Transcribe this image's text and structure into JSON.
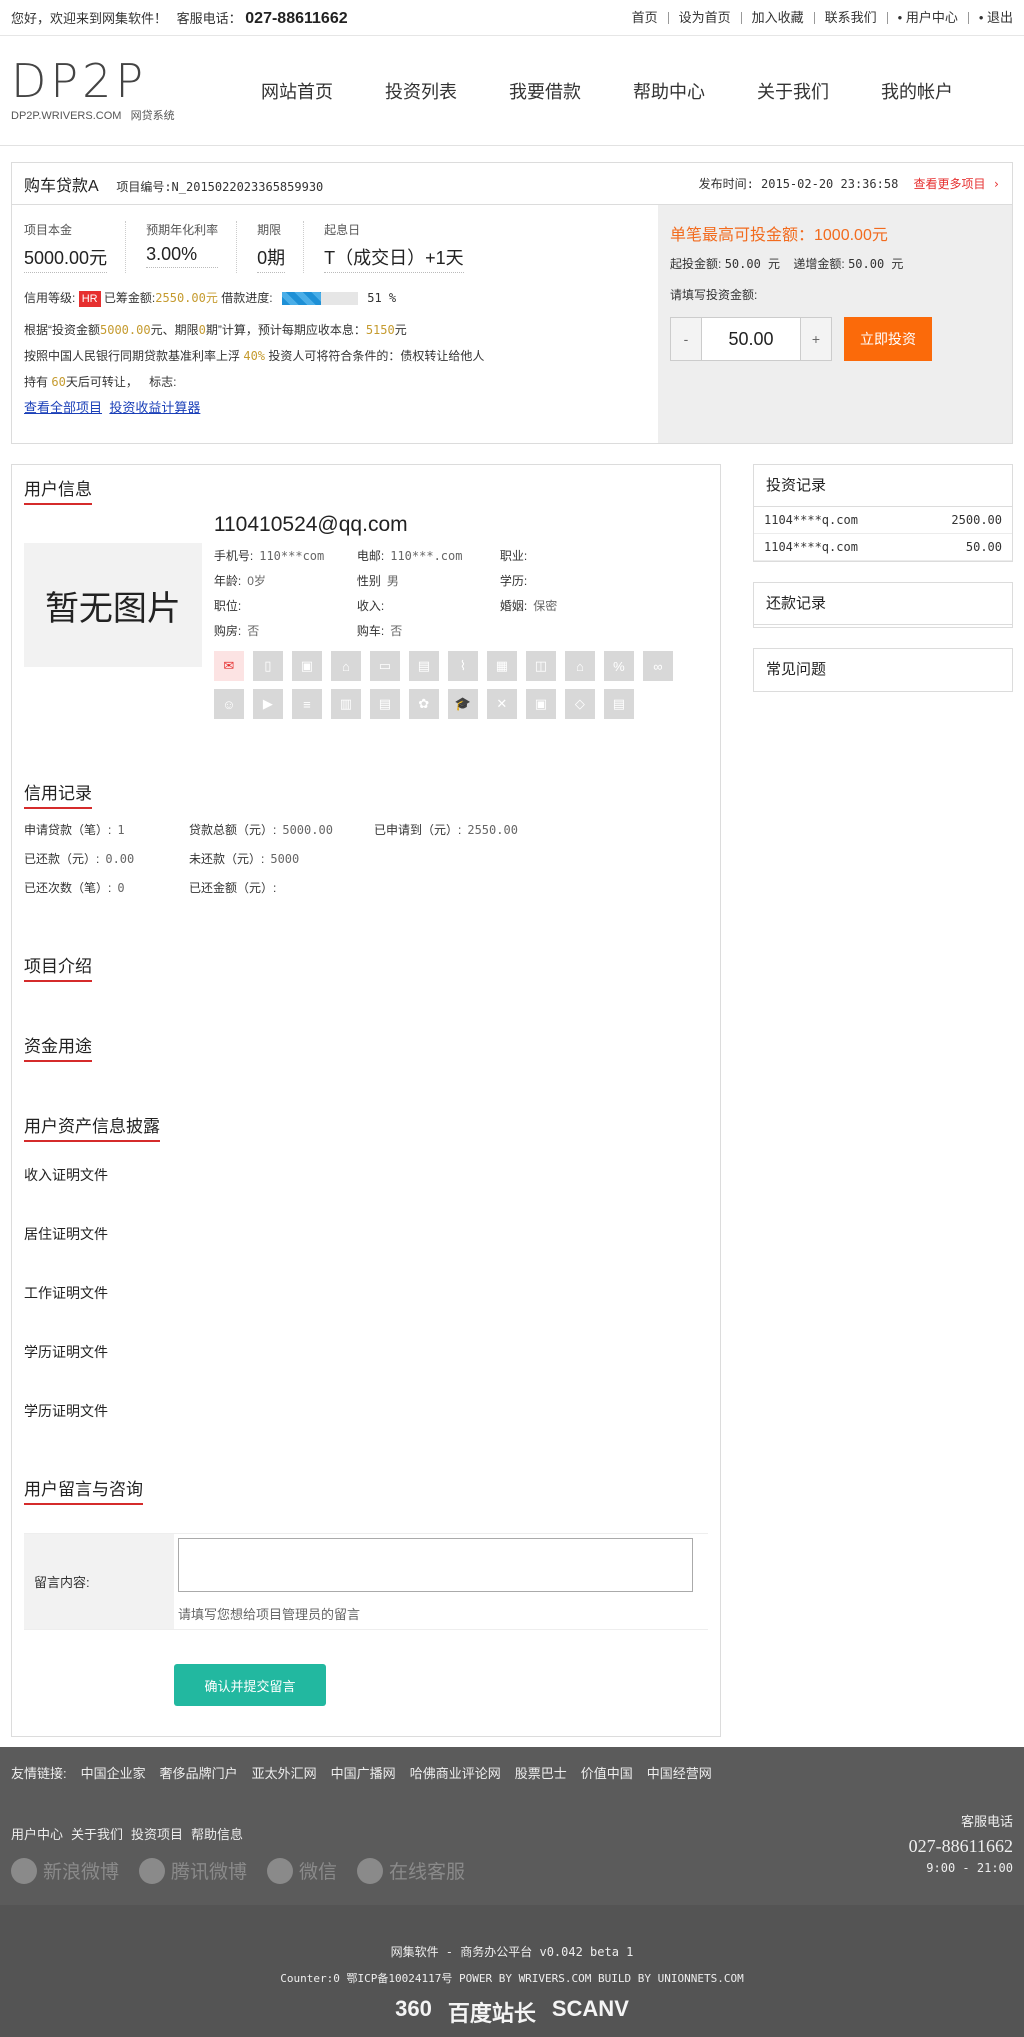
{
  "topbar": {
    "welcome": "您好，欢迎来到网集软件！",
    "service_label": "客服电话：",
    "phone": "027-88611662",
    "links": [
      "首页",
      "设为首页",
      "加入收藏",
      "联系我们",
      "• 用户中心",
      "• 退出"
    ]
  },
  "header": {
    "logo": "DP2P",
    "logo_site": "DP2P.WRIVERS.COM",
    "logo_sub": "网贷系统",
    "nav": [
      "网站首页",
      "投资列表",
      "我要借款",
      "帮助中心",
      "关于我们",
      "我的帐户"
    ]
  },
  "project": {
    "title": "购车贷款A",
    "number_label": "项目编号:",
    "number": "N_2015022023365859930",
    "publish_label": "发布时间:",
    "publish_time": "2015-02-20 23:36:58",
    "more": "查看更多项目 ›",
    "stats": [
      {
        "label": "项目本金",
        "value": "5000.00元"
      },
      {
        "label": "预期年化利率",
        "value": "3.00%"
      },
      {
        "label": "期限",
        "value": "0期"
      },
      {
        "label": "起息日",
        "value": "T（成交日）+1天"
      }
    ],
    "credit_label": "信用等级:",
    "credit_badge": "HR",
    "raised_label": "已筹金额:",
    "raised": "2550.00元",
    "progress_label": "借款进度:",
    "progress": 0.51,
    "progress_text": "51 %",
    "calc_line_1a": "根据“投资金额",
    "calc_amount": "5000.00",
    "calc_line_1b": "元、期限",
    "calc_period": "0",
    "calc_line_1c": "期”计算，预计每期应收本息：",
    "calc_income": "5150",
    "calc_line_1d": "元",
    "rate_line_a": "按照中国人民银行同期贷款基准利率上浮",
    "rate_float": "40%",
    "rate_line_b": "投资人可将符合条件的：债权转让给他人",
    "hold_a": "持有",
    "hold_days": "60",
    "hold_b": "天后可转让，",
    "hold_c": "标志:",
    "link_all": "查看全部项目",
    "link_calc": "投资收益计算器",
    "max_invest": "单笔最高可投金额：1000.00元",
    "min_label": "起投金额:",
    "min_value": "50.00 元",
    "step_label": "递增金额:",
    "step_value": "50.00 元",
    "input_label": "请填写投资金额:",
    "minus": "-",
    "amount": "50.00",
    "plus": "+",
    "invest_btn": "立即投资"
  },
  "user": {
    "section": "用户信息",
    "no_pic": "暂无图片",
    "email": "110410524@qq.com",
    "fields": [
      {
        "k": "手机号:",
        "v": "110***com"
      },
      {
        "k": "电邮:",
        "v": "110***.com"
      },
      {
        "k": "职业:",
        "v": ""
      },
      {
        "k": "年龄:",
        "v": "0岁"
      },
      {
        "k": "性别",
        "v": "男"
      },
      {
        "k": "学历:",
        "v": ""
      },
      {
        "k": "职位:",
        "v": ""
      },
      {
        "k": "收入:",
        "v": ""
      },
      {
        "k": "婚姻:",
        "v": "保密"
      },
      {
        "k": "购房:",
        "v": "否"
      },
      {
        "k": "购车:",
        "v": "否"
      },
      {
        "k": "",
        "v": ""
      }
    ],
    "icons": [
      "mail-icon",
      "phone-icon",
      "image-icon",
      "bank-icon",
      "wallet-icon",
      "id-card-icon",
      "tie-icon",
      "grid-icon",
      "car-icon",
      "house-icon",
      "percent-icon",
      "link-icon",
      "person-icon",
      "video-icon",
      "server-icon",
      "building-icon",
      "bag-icon",
      "apple-icon",
      "graduation-icon",
      "tools-icon",
      "briefcase-icon",
      "shield-icon",
      "card-icon"
    ]
  },
  "credit": {
    "section": "信用记录",
    "items": [
      {
        "k": "申请贷款（笔）:",
        "v": "1"
      },
      {
        "k": "贷款总额（元）:",
        "v": "5000.00"
      },
      {
        "k": "已申请到（元）:",
        "v": "2550.00"
      },
      {
        "k": "已还款（元）:",
        "v": "0.00"
      },
      {
        "k": "未还款（元）:",
        "v": "5000"
      },
      {
        "k": "",
        "v": ""
      },
      {
        "k": "已还次数（笔）:",
        "v": "0"
      },
      {
        "k": "已还金额（元）:",
        "v": ""
      },
      {
        "k": "",
        "v": ""
      }
    ]
  },
  "sections": {
    "intro": "项目介绍",
    "usage": "资金用途",
    "assets": "用户资产信息披露",
    "files": [
      "收入证明文件",
      "居住证明文件",
      "工作证明文件",
      "学历证明文件",
      "学历证明文件"
    ],
    "message": "用户留言与咨询",
    "msg_label": "留言内容:",
    "msg_hint": "请填写您想给项目管理员的留言",
    "submit": "确认并提交留言"
  },
  "sidebar": {
    "invest_title": "投资记录",
    "invest_rows": [
      {
        "user": "1104****q.com",
        "amount": "2500.00"
      },
      {
        "user": "1104****q.com",
        "amount": "50.00"
      }
    ],
    "repay_title": "还款记录",
    "faq_title": "常见问题"
  },
  "footer": {
    "friends_label": "友情链接:",
    "friends": [
      "中国企业家",
      "奢侈品牌门户",
      "亚太外汇网",
      "中国广播网",
      "哈佛商业评论网",
      "股票巴士",
      "价值中国",
      "中国经营网"
    ],
    "links": [
      "用户中心",
      "关于我们",
      "投资项目",
      "帮助信息"
    ],
    "social": [
      "新浪微博",
      "腾讯微博",
      "微信",
      "在线客服"
    ],
    "service_label": "客服电话",
    "phone": "027-88611662",
    "hours": "9:00 - 21:00",
    "copyright": "网集软件 - 商务办公平台 v0.042 beta 1",
    "counter": "Counter:0 鄂ICP备10024117号 POWER BY WRIVERS.COM  BUILD BY UNIONNETS.COM",
    "badges": [
      "360",
      "百度站长",
      "SCANV"
    ]
  }
}
